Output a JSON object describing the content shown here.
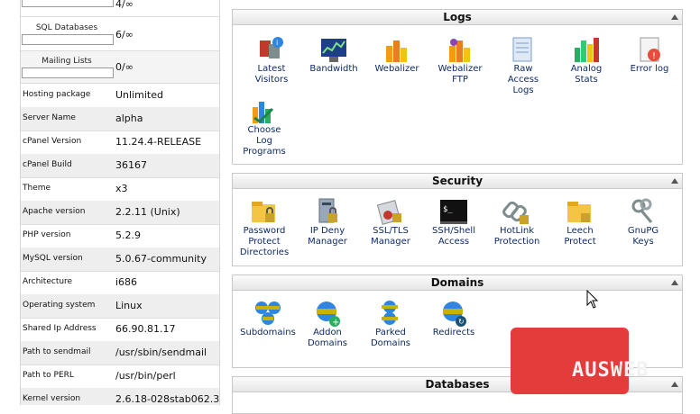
{
  "stats": [
    {
      "label": "",
      "value": "4/∞"
    },
    {
      "label": "SQL Databases",
      "value": "6/∞"
    },
    {
      "label": "Mailing Lists",
      "value": "0/∞"
    }
  ],
  "info": [
    {
      "label": "Hosting package",
      "value": "Unlimited"
    },
    {
      "label": "Server Name",
      "value": "alpha"
    },
    {
      "label": "cPanel Version",
      "value": "11.24.4-RELEASE"
    },
    {
      "label": "cPanel Build",
      "value": "36167"
    },
    {
      "label": "Theme",
      "value": "x3"
    },
    {
      "label": "Apache version",
      "value": "2.2.11 (Unix)"
    },
    {
      "label": "PHP version",
      "value": "5.2.9"
    },
    {
      "label": "MySQL version",
      "value": "5.0.67-community"
    },
    {
      "label": "Architecture",
      "value": "i686"
    },
    {
      "label": "Operating system",
      "value": "Linux"
    },
    {
      "label": "Shared Ip Address",
      "value": "66.90.81.17"
    },
    {
      "label": "Path to sendmail",
      "value": "/usr/sbin/sendmail"
    },
    {
      "label": "Path to PERL",
      "value": "/usr/bin/perl"
    },
    {
      "label": "Kernel version",
      "value": "2.6.18-028stab062.3"
    }
  ],
  "logs": {
    "title": "Logs",
    "items": [
      {
        "label": [
          "Latest",
          "Visitors"
        ],
        "icon": "latest-visitors-icon"
      },
      {
        "label": [
          "Bandwidth"
        ],
        "icon": "bandwidth-icon"
      },
      {
        "label": [
          "Webalizer"
        ],
        "icon": "webalizer-icon"
      },
      {
        "label": [
          "Webalizer",
          "FTP"
        ],
        "icon": "webalizer-ftp-icon"
      },
      {
        "label": [
          "Raw",
          "Access",
          "Logs"
        ],
        "icon": "raw-access-logs-icon"
      },
      {
        "label": [
          "Analog",
          "Stats"
        ],
        "icon": "analog-stats-icon"
      },
      {
        "label": [
          "Error log"
        ],
        "icon": "error-log-icon"
      },
      {
        "label": [
          "Choose",
          "Log",
          "Programs"
        ],
        "icon": "choose-log-programs-icon"
      }
    ]
  },
  "security": {
    "title": "Security",
    "items": [
      {
        "label": [
          "Password",
          "Protect",
          "Directories"
        ],
        "icon": "password-protect-icon"
      },
      {
        "label": [
          "IP Deny",
          "Manager"
        ],
        "icon": "ip-deny-icon"
      },
      {
        "label": [
          "SSL/TLS",
          "Manager"
        ],
        "icon": "ssl-tls-icon"
      },
      {
        "label": [
          "SSH/Shell",
          "Access"
        ],
        "icon": "ssh-shell-icon"
      },
      {
        "label": [
          "HotLink",
          "Protection"
        ],
        "icon": "hotlink-icon"
      },
      {
        "label": [
          "Leech",
          "Protect"
        ],
        "icon": "leech-protect-icon"
      },
      {
        "label": [
          "GnuPG",
          "Keys"
        ],
        "icon": "gnupg-keys-icon"
      }
    ]
  },
  "domains": {
    "title": "Domains",
    "items": [
      {
        "label": [
          "Subdomains"
        ],
        "icon": "subdomains-icon"
      },
      {
        "label": [
          "Addon",
          "Domains"
        ],
        "icon": "addon-domains-icon"
      },
      {
        "label": [
          "Parked",
          "Domains"
        ],
        "icon": "parked-domains-icon"
      },
      {
        "label": [
          "Redirects"
        ],
        "icon": "redirects-icon"
      }
    ]
  },
  "databases": {
    "title": "Databases"
  },
  "watermark": {
    "text": "AUSWEB",
    "color": "#e43b3b"
  }
}
